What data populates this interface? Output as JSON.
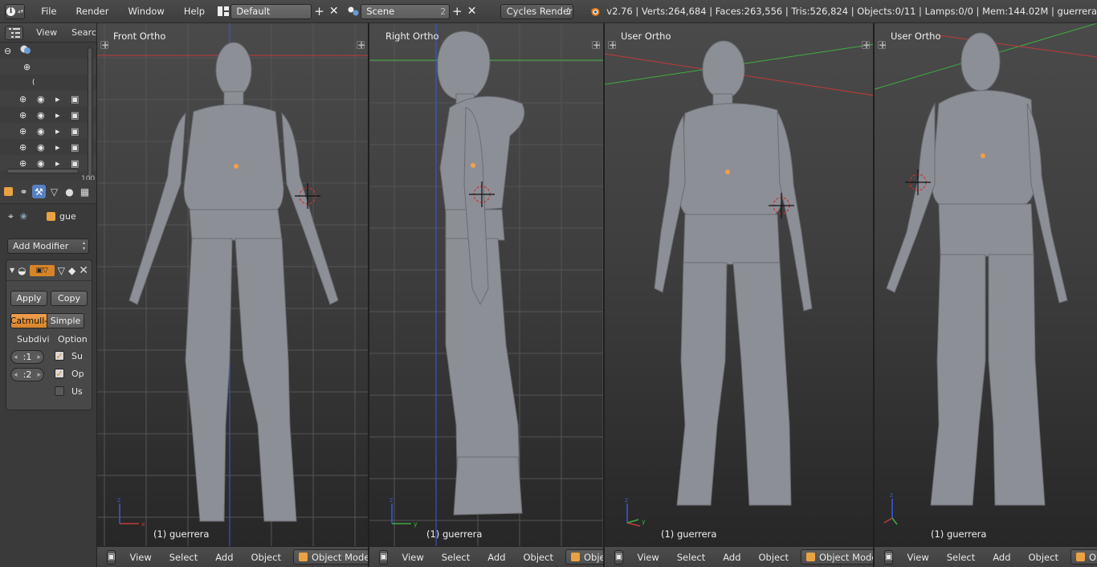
{
  "topbar": {
    "menus": [
      "File",
      "Render",
      "Window",
      "Help"
    ],
    "screen_layout": "Default",
    "scene": "Scene",
    "scene_users": "2",
    "render_engine": "Cycles Render",
    "stats": "v2.76 | Verts:264,684 | Faces:263,556 | Tris:526,824 | Objects:0/11 | Lamps:0/0 | Mem:144.02M | guerrera"
  },
  "outliner": {
    "view_label": "View",
    "search_label": "Searc",
    "scroll_value": "100"
  },
  "properties": {
    "object_name": "gue",
    "add_modifier": "Add Modifier",
    "apply_label": "Apply",
    "copy_label": "Copy",
    "catmull_label": "Catmull-",
    "simple_label": "Simple",
    "subdiv_label": "Subdivi",
    "options_label": "Option",
    "view_levels": ":1",
    "render_levels": ":2",
    "check1_label": "Su",
    "check2_label": "Op",
    "check3_label": "Us"
  },
  "viewports": [
    {
      "label": "Front Ortho",
      "object": "(1) guerrera",
      "menus": [
        "View",
        "Select",
        "Add",
        "Object"
      ],
      "mode": "Object Mode"
    },
    {
      "label": "Right Ortho",
      "object": "(1) guerrera",
      "menus": [
        "View",
        "Select",
        "Add",
        "Object"
      ],
      "mode": "Object"
    },
    {
      "label": "User Ortho",
      "object": "(1) guerrera",
      "menus": [
        "View",
        "Select",
        "Add",
        "Object"
      ],
      "mode": "Object Mode"
    },
    {
      "label": "User Ortho",
      "object": "(1) guerrera",
      "menus": [
        "View",
        "Select",
        "Add",
        "Object"
      ],
      "mode": "Obje"
    }
  ],
  "colors": {
    "accent_orange": "#e9a242",
    "x_axis": "#c23a3a",
    "y_axis": "#3fae3f",
    "z_axis": "#3a5ad8",
    "model": "#8d8f96"
  }
}
